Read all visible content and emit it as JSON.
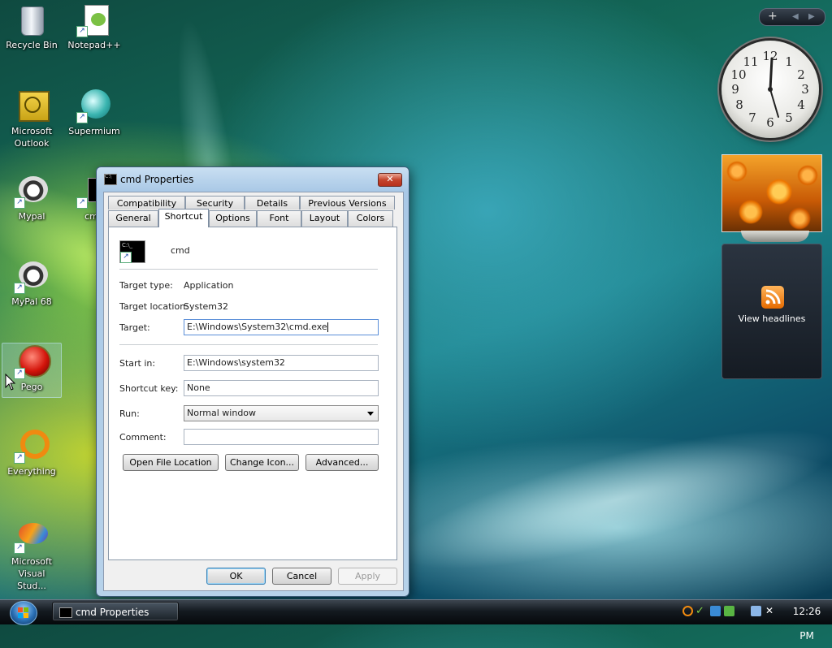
{
  "desktop": {
    "icons": [
      {
        "label": "Recycle Bin"
      },
      {
        "label": "Notepad++"
      },
      {
        "label": "Microsoft Outlook"
      },
      {
        "label": "Supermium"
      },
      {
        "label": "Mypal"
      },
      {
        "label": "cmd"
      },
      {
        "label": "MyPal 68"
      },
      {
        "label": "Pego"
      },
      {
        "label": "Everything"
      },
      {
        "label": "Microsoft Visual Stud..."
      }
    ]
  },
  "window": {
    "title": "cmd Properties",
    "close_label": "✕",
    "tabs_row1": [
      "Compatibility",
      "Security",
      "Details",
      "Previous Versions"
    ],
    "tabs_row2": [
      "General",
      "Shortcut",
      "Options",
      "Font",
      "Layout",
      "Colors"
    ],
    "active_tab": "Shortcut",
    "shortcut_name": "cmd",
    "fields": {
      "target_type_label": "Target type:",
      "target_type_value": "Application",
      "target_location_label": "Target location:",
      "target_location_value": "System32",
      "target_label": "Target:",
      "target_value": "E:\\Windows\\System32\\cmd.exe",
      "start_in_label": "Start in:",
      "start_in_value": "E:\\Windows\\system32",
      "shortcut_key_label": "Shortcut key:",
      "shortcut_key_value": "None",
      "run_label": "Run:",
      "run_value": "Normal window",
      "comment_label": "Comment:",
      "comment_value": ""
    },
    "buttons": {
      "open_file_location": "Open File Location",
      "change_icon": "Change Icon...",
      "advanced": "Advanced...",
      "ok": "OK",
      "cancel": "Cancel",
      "apply": "Apply"
    }
  },
  "sidebar": {
    "controls": "+",
    "clock_numbers": [
      "12",
      "1",
      "2",
      "3",
      "4",
      "5",
      "6",
      "7",
      "8",
      "9",
      "10",
      "11"
    ],
    "feed_label": "View headlines"
  },
  "taskbar": {
    "task_button": "cmd Properties",
    "clock": "12:26 PM"
  },
  "colors": {
    "accent": "#3c7fb1",
    "close_red": "#c4442d",
    "rss_orange": "#f08a1c"
  }
}
